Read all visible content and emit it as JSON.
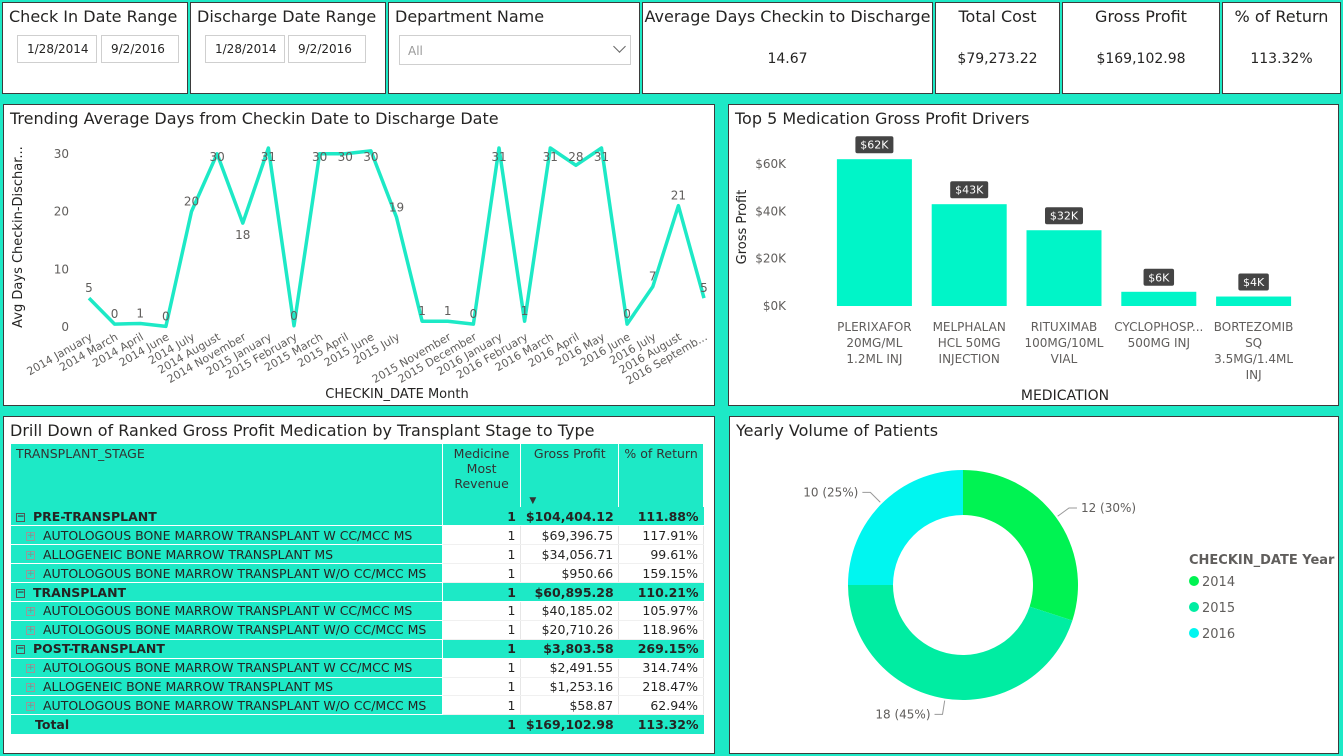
{
  "filters": {
    "checkin": {
      "title": "Check In Date Range",
      "start": "1/28/2014",
      "end": "9/2/2016"
    },
    "discharge": {
      "title": "Discharge Date Range",
      "start": "1/28/2014",
      "end": "9/2/2016"
    },
    "department": {
      "title": "Department Name",
      "selected": "All"
    }
  },
  "kpis": {
    "avg_days": {
      "title": "Average Days Checkin to Discharge",
      "value": "14.67"
    },
    "total_cost": {
      "title": "Total Cost",
      "value": "$79,273.22"
    },
    "gross_profit": {
      "title": "Gross Profit",
      "value": "$169,102.98"
    },
    "pct_return": {
      "title": "% of Return",
      "value": "113.32%"
    }
  },
  "colors": {
    "accent": "#1de9c6",
    "line": "#1de9c6",
    "bar": "#00f5c8",
    "donut_2014": "#00f352",
    "donut_2015": "#00eda2",
    "donut_2016": "#00f6f0"
  },
  "chart_data": [
    {
      "type": "line",
      "title": "Trending Average Days from Checkin Date to Discharge Date",
      "xlabel": "CHECKIN_DATE Month",
      "ylabel": "Avg Days Checkin-Dischar...",
      "ylim": [
        0,
        31
      ],
      "yticks": [
        0,
        10,
        20,
        30
      ],
      "categories": [
        "2014 January",
        "2014 March",
        "2014 April",
        "2014 June",
        "2014 July",
        "2014 August",
        "2014 November",
        "2015 January",
        "2015 February",
        "2015 March",
        "2015 April",
        "2015 June",
        "2015 July",
        "2015 August",
        "2015 November",
        "2015 December",
        "2016 January",
        "2016 February",
        "2016 March",
        "2016 April",
        "2016 May",
        "2016 June",
        "2016 July",
        "2016 August",
        "2016 September"
      ],
      "xtick_labels": [
        "2014 January",
        "2014 March",
        "2014 April",
        "2014 June",
        "2014 July",
        "2014 August",
        "2014 November",
        "2015 January",
        "2015 February",
        "2015 March",
        "2015 April",
        "2015 June",
        "2015 July",
        "2015 November",
        "2015 December",
        "2016 January",
        "2016 February",
        "2016 March",
        "2016 April",
        "2016 May",
        "2016 June",
        "2016 July",
        "2016 August",
        "2016 Septemb..."
      ],
      "xtick_index": [
        0,
        1,
        2,
        3,
        4,
        5,
        6,
        7,
        8,
        9,
        10,
        11,
        12,
        14,
        15,
        16,
        17,
        18,
        19,
        20,
        21,
        22,
        23,
        24
      ],
      "values": [
        5,
        0.5,
        0.6,
        0.1,
        20,
        30,
        18,
        31,
        0.2,
        30,
        30,
        30.5,
        19,
        1,
        1,
        0.5,
        31,
        1,
        31,
        28,
        31,
        0.5,
        7,
        21,
        5
      ],
      "data_labels": [
        "5",
        "0",
        "1",
        "0",
        "20",
        "30",
        "18",
        "31",
        "0",
        "30",
        "30",
        "30",
        "19",
        "1",
        "1",
        "0",
        "31",
        "1",
        "31",
        "28",
        "31",
        "0",
        "7",
        "21",
        "5"
      ],
      "grid": false
    },
    {
      "type": "bar",
      "title": "Top 5 Medication Gross Profit Drivers",
      "xlabel": "MEDICATION",
      "ylabel": "Gross Profit",
      "ylim": [
        0,
        68000
      ],
      "yticks": [
        0,
        20000,
        40000,
        60000
      ],
      "ytick_labels": [
        "$0K",
        "$20K",
        "$40K",
        "$60K"
      ],
      "categories": [
        [
          "PLERIXAFOR",
          "20MG/ML",
          "1.2ML INJ"
        ],
        [
          "MELPHALAN",
          "HCL 50MG",
          "INJECTION"
        ],
        [
          "RITUXIMAB",
          "100MG/10ML",
          "VIAL"
        ],
        [
          "CYCLOPHOSP...",
          "500MG INJ"
        ],
        [
          "BORTEZOMIB",
          "SQ",
          "3.5MG/1.4ML",
          "INJ"
        ]
      ],
      "values": [
        62000,
        43000,
        32000,
        6000,
        4000
      ],
      "data_labels": [
        "$62K",
        "$43K",
        "$32K",
        "$6K",
        "$4K"
      ],
      "grid": false
    },
    {
      "type": "pie",
      "title": "Yearly Volume of Patients",
      "legend_title": "CHECKIN_DATE Year",
      "legend_position": "right",
      "series": [
        {
          "name": "2014",
          "value": 12,
          "label": "12 (30%)"
        },
        {
          "name": "2015",
          "value": 18,
          "label": "18 (45%)"
        },
        {
          "name": "2016",
          "value": 10,
          "label": "10 (25%)"
        }
      ]
    }
  ],
  "drilldown": {
    "title": "Drill Down of Ranked Gross Profit Medication by Transplant Stage to Type",
    "columns": [
      "TRANSPLANT_STAGE",
      "Medicine Most Revenue",
      "Gross Profit",
      "% of Return"
    ],
    "stages": [
      {
        "name": "PRE-TRANSPLANT",
        "rank": "1",
        "profit": "$104,404.12",
        "ret": "111.88%",
        "rows": [
          {
            "name": "AUTOLOGOUS BONE MARROW TRANSPLANT W CC/MCC MS",
            "rank": "1",
            "profit": "$69,396.75",
            "ret": "117.91%"
          },
          {
            "name": "ALLOGENEIC BONE MARROW TRANSPLANT MS",
            "rank": "1",
            "profit": "$34,056.71",
            "ret": "99.61%"
          },
          {
            "name": "AUTOLOGOUS BONE MARROW TRANSPLANT W/O CC/MCC MS",
            "rank": "1",
            "profit": "$950.66",
            "ret": "159.15%"
          }
        ]
      },
      {
        "name": "TRANSPLANT",
        "rank": "1",
        "profit": "$60,895.28",
        "ret": "110.21%",
        "rows": [
          {
            "name": "AUTOLOGOUS BONE MARROW TRANSPLANT W CC/MCC MS",
            "rank": "1",
            "profit": "$40,185.02",
            "ret": "105.97%"
          },
          {
            "name": "AUTOLOGOUS BONE MARROW TRANSPLANT W/O CC/MCC MS",
            "rank": "1",
            "profit": "$20,710.26",
            "ret": "118.96%"
          }
        ]
      },
      {
        "name": "POST-TRANSPLANT",
        "rank": "1",
        "profit": "$3,803.58",
        "ret": "269.15%",
        "rows": [
          {
            "name": "AUTOLOGOUS BONE MARROW TRANSPLANT W CC/MCC MS",
            "rank": "1",
            "profit": "$2,491.55",
            "ret": "314.74%"
          },
          {
            "name": "ALLOGENEIC BONE MARROW TRANSPLANT MS",
            "rank": "1",
            "profit": "$1,253.16",
            "ret": "218.47%"
          },
          {
            "name": "AUTOLOGOUS BONE MARROW TRANSPLANT W/O CC/MCC MS",
            "rank": "1",
            "profit": "$58.87",
            "ret": "62.94%"
          }
        ]
      }
    ],
    "total": {
      "name": "Total",
      "rank": "1",
      "profit": "$169,102.98",
      "ret": "113.32%"
    }
  }
}
